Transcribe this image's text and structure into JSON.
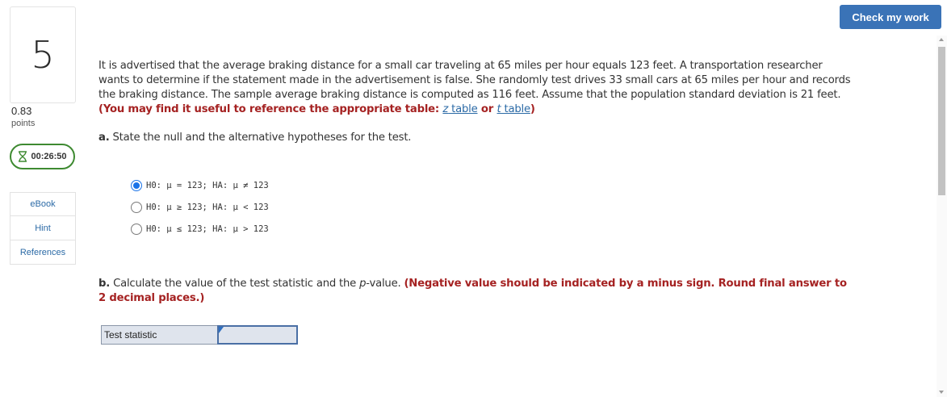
{
  "question_number": "5",
  "points": {
    "value": "0.83",
    "label": "points"
  },
  "timer": {
    "value": "00:26:50",
    "icon": "hourglass-icon",
    "color": "#3e8a31"
  },
  "tools": [
    {
      "label": "eBook"
    },
    {
      "label": "Hint"
    },
    {
      "label": "References"
    }
  ],
  "check_button": {
    "label": "Check my work",
    "color": "#3a73b7"
  },
  "question": {
    "text": "It is advertised that the average braking distance for a small car traveling at 65 miles per hour equals 123 feet. A transportation researcher wants to determine if the statement made in the advertisement is false. She randomly test drives 33 small cars at 65 miles per hour and records the braking distance. The sample average braking distance is computed as 116 feet. Assume that the population standard deviation is 21 feet.",
    "note_prefix": "(You may find it useful to reference the appropriate table:",
    "z_table_italic": "z",
    "z_table_rest": " table",
    "or": "or",
    "t_table_italic": "t",
    "t_table_rest": " table",
    "note_suffix": ")"
  },
  "part_a": {
    "label": "a.",
    "text": "State the null and the alternative hypotheses for the test.",
    "options": [
      {
        "text": "H0: μ = 123; HA: μ ≠ 123",
        "selected": true
      },
      {
        "text": "H0: μ ≥ 123; HA: μ < 123",
        "selected": false
      },
      {
        "text": "H0: μ ≤ 123; HA: μ > 123",
        "selected": false
      }
    ]
  },
  "part_b": {
    "label": "b.",
    "text_before": "Calculate the value of the test statistic and the ",
    "p_italic": "p",
    "text_after": "-value.",
    "instruction": "(Negative value should be indicated by a minus sign. Round final answer to 2 decimal places.)",
    "row_label": "Test statistic",
    "input_value": ""
  },
  "colors": {
    "accent": "#3a73b7",
    "instruction_red": "#a52222",
    "link": "#2b6aa6",
    "selected_radio": "#1a73e8"
  }
}
